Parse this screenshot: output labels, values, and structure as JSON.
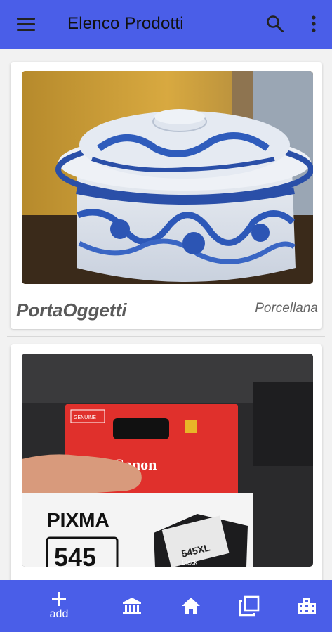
{
  "app_bar": {
    "title": "Elenco Prodotti",
    "icons": [
      "menu-icon",
      "search-icon",
      "more-vert-icon"
    ]
  },
  "products": [
    {
      "name": "PortaOggetti",
      "material": "Porcellana",
      "image": "blue and white porcelain covered box photo"
    },
    {
      "name": "",
      "material": "",
      "image": "Canon PIXMA 545 XL ink cartridge photo"
    }
  ],
  "bottom_nav": {
    "add_label": "add",
    "icons": [
      "add-icon",
      "bank-icon",
      "home-icon",
      "copy-icon",
      "city-icon"
    ]
  },
  "colors": {
    "primary": "#4a5ee8",
    "background": "#f2f2f2",
    "card": "#ffffff"
  }
}
